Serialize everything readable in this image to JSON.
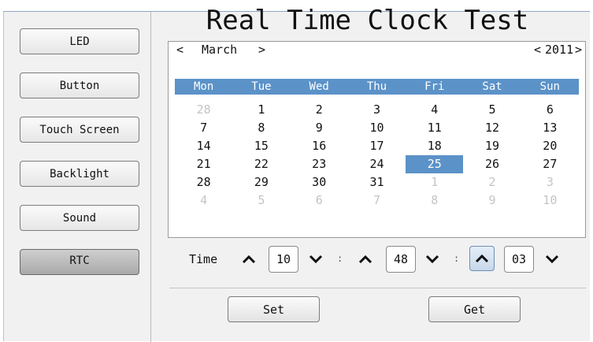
{
  "sidebar": {
    "items": [
      {
        "label": "LED"
      },
      {
        "label": "Button"
      },
      {
        "label": "Touch Screen"
      },
      {
        "label": "Backlight"
      },
      {
        "label": "Sound"
      },
      {
        "label": "RTC"
      }
    ],
    "active": "RTC"
  },
  "title": "Real Time Clock Test",
  "calendar": {
    "month_prev": "<",
    "month": "March",
    "month_next": ">",
    "year_prev": "<",
    "year": "2011",
    "year_next": ">",
    "weekdays": [
      "Mon",
      "Tue",
      "Wed",
      "Thu",
      "Fri",
      "Sat",
      "Sun"
    ],
    "weeks": [
      [
        "28",
        "1",
        "2",
        "3",
        "4",
        "5",
        "6"
      ],
      [
        "7",
        "8",
        "9",
        "10",
        "11",
        "12",
        "13"
      ],
      [
        "14",
        "15",
        "16",
        "17",
        "18",
        "19",
        "20"
      ],
      [
        "21",
        "22",
        "23",
        "24",
        "25",
        "26",
        "27"
      ],
      [
        "28",
        "29",
        "30",
        "31",
        "1",
        "2",
        "3"
      ],
      [
        "4",
        "5",
        "6",
        "7",
        "8",
        "9",
        "10"
      ]
    ],
    "selected_day": "25",
    "accent": "#5b92c8"
  },
  "time": {
    "label": "Time",
    "hour": "10",
    "minute": "48",
    "second": "03",
    "separator": ":"
  },
  "actions": {
    "set_label": "Set",
    "get_label": "Get"
  }
}
